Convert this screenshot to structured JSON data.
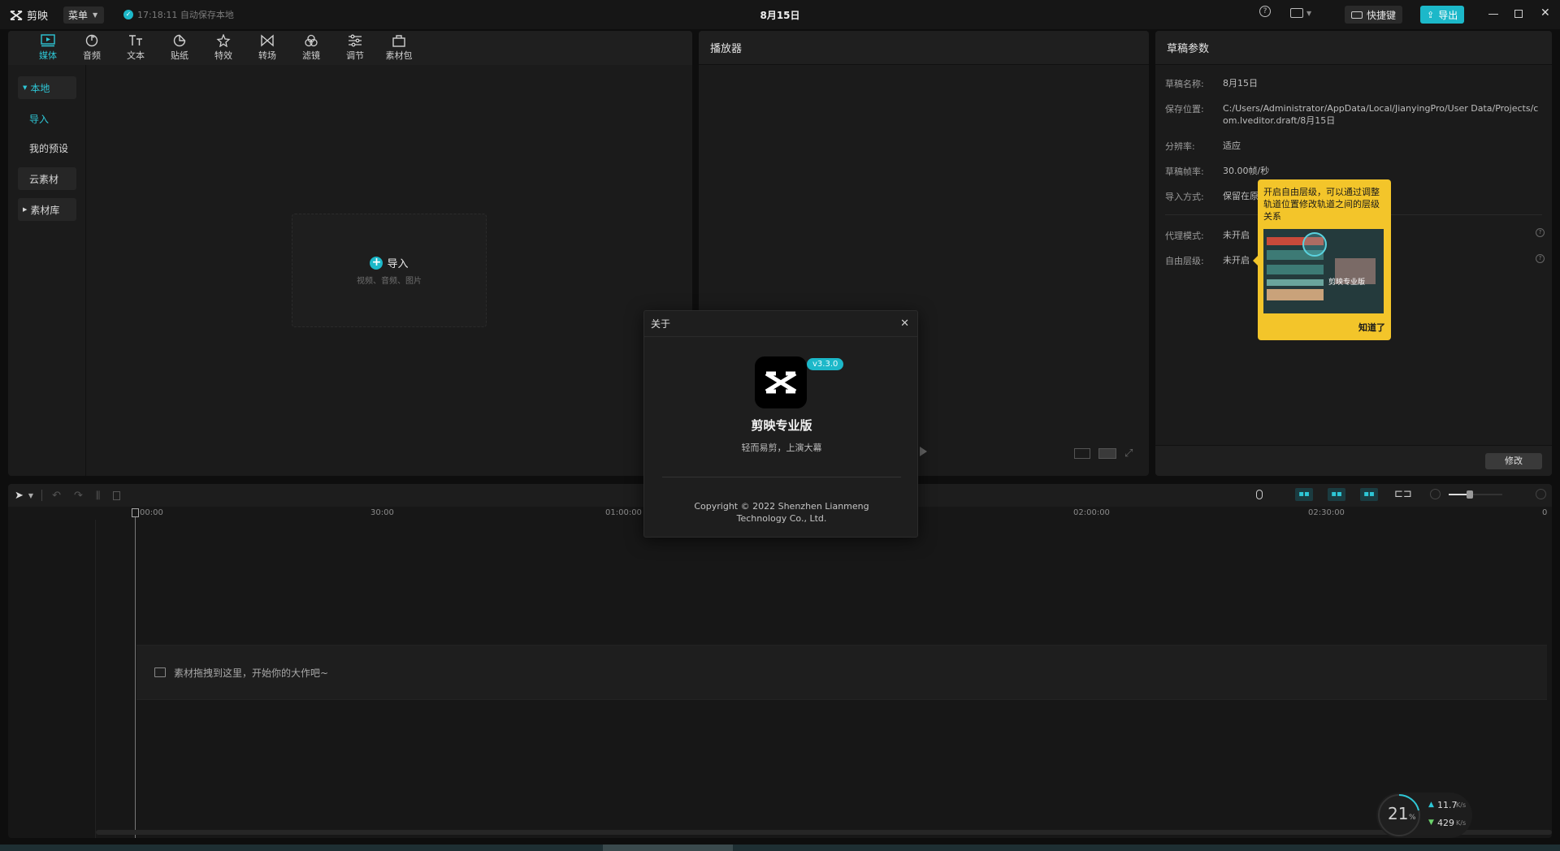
{
  "app": {
    "logo_text": "剪映",
    "menu_label": "菜单",
    "autosave": "17:18:11 自动保存本地",
    "doc_title": "8月15日",
    "shortcut_label": "快捷键",
    "export_label": "导出"
  },
  "media": {
    "tabs": [
      {
        "label": "媒体",
        "icon": "media-icon"
      },
      {
        "label": "音频",
        "icon": "audio-icon"
      },
      {
        "label": "文本",
        "icon": "text-icon"
      },
      {
        "label": "贴纸",
        "icon": "sticker-icon"
      },
      {
        "label": "特效",
        "icon": "effects-icon"
      },
      {
        "label": "转场",
        "icon": "transition-icon"
      },
      {
        "label": "滤镜",
        "icon": "filter-icon"
      },
      {
        "label": "调节",
        "icon": "adjust-icon"
      },
      {
        "label": "素材包",
        "icon": "package-icon"
      }
    ],
    "sidebar": {
      "local": "本地",
      "import": "导入",
      "presets": "我的预设",
      "cloud": "云素材",
      "library": "素材库"
    },
    "dropzone": {
      "title": "导入",
      "subtitle": "视频、音频、图片"
    }
  },
  "player": {
    "title": "播放器"
  },
  "draft": {
    "title": "草稿参数",
    "rows": [
      {
        "label": "草稿名称:",
        "value": "8月15日"
      },
      {
        "label": "保存位置:",
        "value": "C:/Users/Administrator/AppData/Local/JianyingPro/User Data/Projects/com.lveditor.draft/8月15日"
      },
      {
        "label": "分辨率:",
        "value": "适应"
      },
      {
        "label": "草稿帧率:",
        "value": "30.00帧/秒"
      },
      {
        "label": "导入方式:",
        "value": "保留在原"
      }
    ],
    "rows2": [
      {
        "label": "代理模式:",
        "value": "未开启"
      },
      {
        "label": "自由层级:",
        "value": "未开启"
      }
    ],
    "edit_button": "修改"
  },
  "tooltip": {
    "text": "开启自由层级，可以通过调整轨道位置修改轨道之间的层级关系",
    "image_caption": "剪映专业版",
    "ok": "知道了"
  },
  "about": {
    "title": "关于",
    "version": "v3.3.0",
    "app_name": "剪映专业版",
    "slogan": "轻而易剪，上演大幕",
    "copyright": "Copyright © 2022 Shenzhen Lianmeng Technology Co., Ltd."
  },
  "timeline": {
    "ticks": [
      "00:00",
      "30:00",
      "01:00:00",
      "02:00:00",
      "02:30:00",
      "0"
    ],
    "drop_hint": "素材拖拽到这里，开始你的大作吧~"
  },
  "netmon": {
    "cpu": "21",
    "unit": "%",
    "up": "11.7",
    "down": "429",
    "rate_unit": "K/s"
  },
  "colors": {
    "accent": "#2ec7d6",
    "export": "#1cb8c9",
    "tooltip_bg": "#f3c52a"
  }
}
